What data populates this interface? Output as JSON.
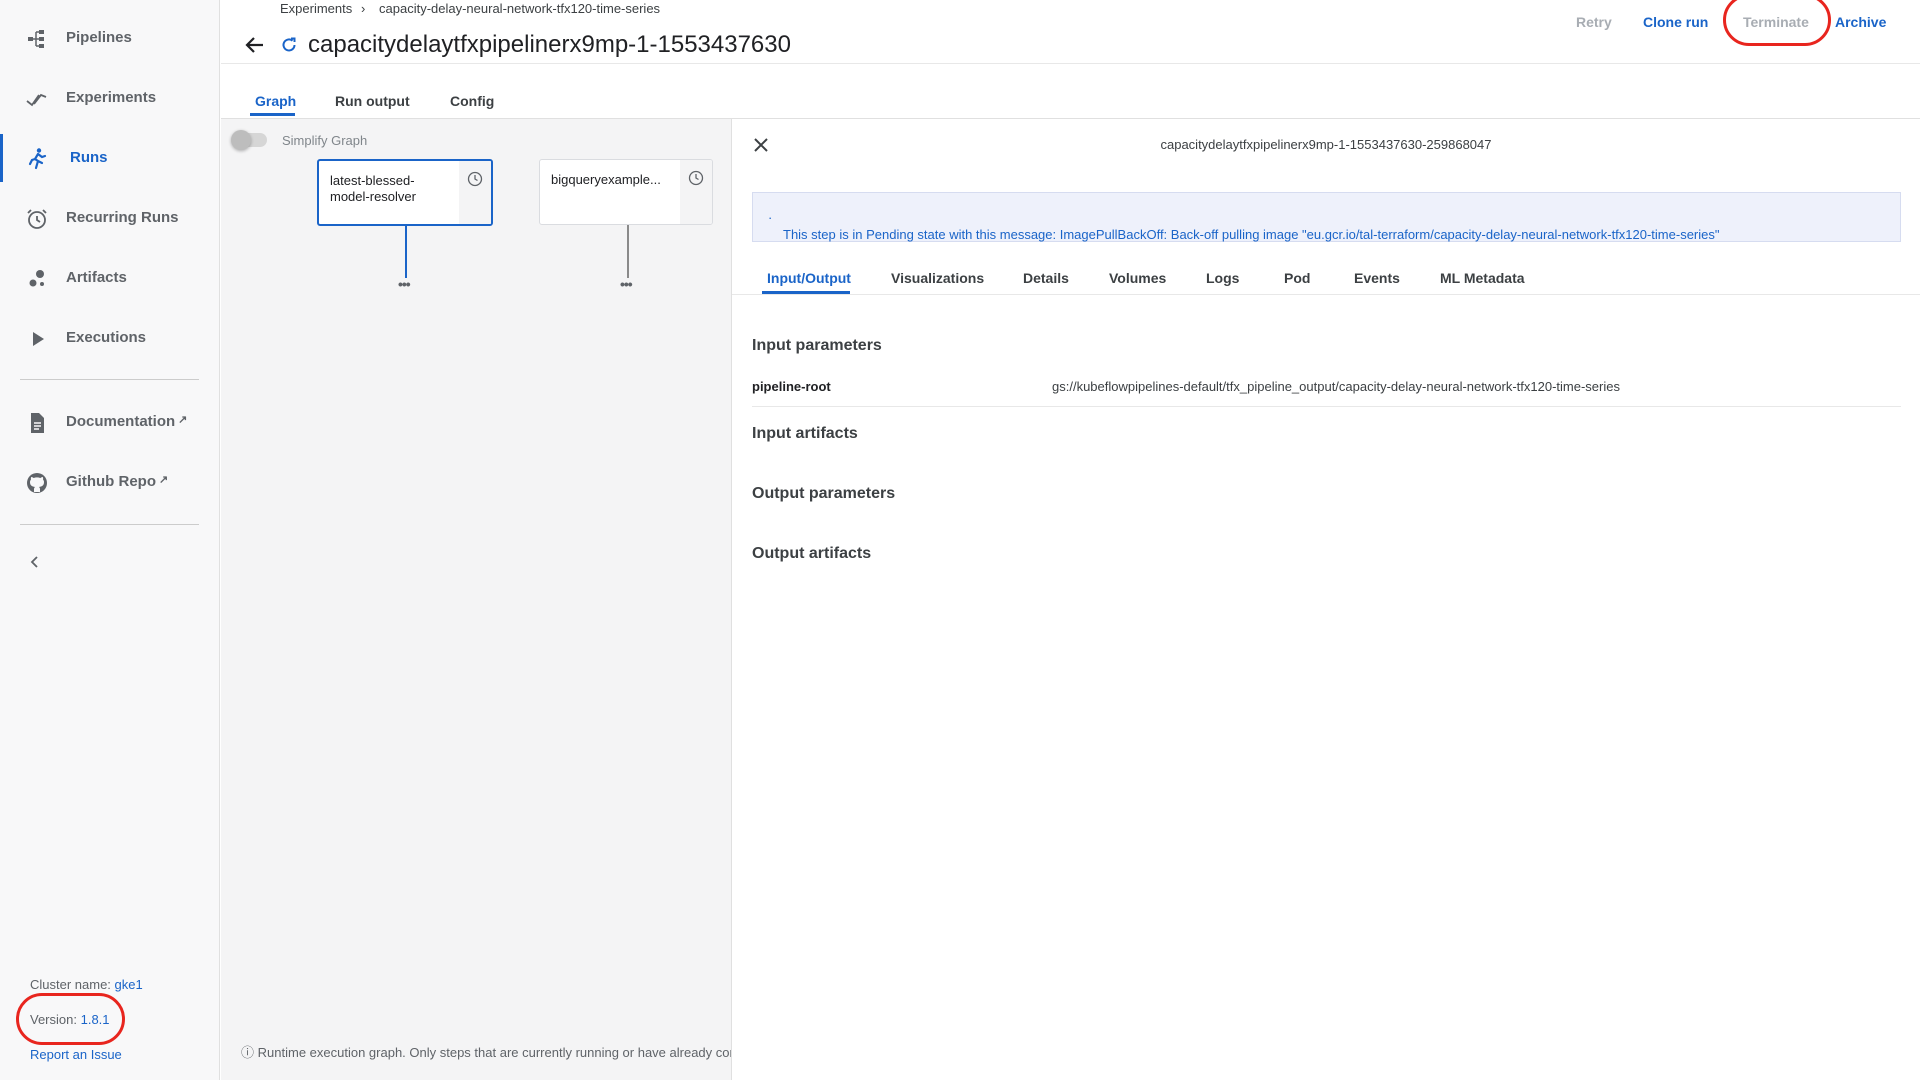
{
  "sidebar": {
    "items": [
      {
        "label": "Pipelines",
        "icon": "pipelines-icon",
        "active": false
      },
      {
        "label": "Experiments",
        "icon": "experiments-icon",
        "active": false
      },
      {
        "label": "Runs",
        "icon": "runs-icon",
        "active": true
      },
      {
        "label": "Recurring Runs",
        "icon": "alarm-clock-icon",
        "active": false
      },
      {
        "label": "Artifacts",
        "icon": "artifacts-icon",
        "active": false
      },
      {
        "label": "Executions",
        "icon": "play-icon",
        "active": false
      }
    ],
    "links": [
      {
        "label": "Documentation",
        "icon": "document-icon"
      },
      {
        "label": "Github Repo",
        "icon": "github-icon"
      }
    ],
    "footer": {
      "cluster_label": "Cluster name:",
      "cluster_value": "gke1",
      "version_label": "Version:",
      "version_value": "1.8.1",
      "report_label": "Report an Issue"
    }
  },
  "header": {
    "breadcrumb": [
      "Experiments",
      "capacity-delay-neural-network-tfx120-time-series"
    ],
    "breadcrumb_separator": "›",
    "title": "capacitydelaytfxpipelinerx9mp-1-1553437630",
    "actions": [
      {
        "label": "Retry",
        "disabled": true
      },
      {
        "label": "Clone run",
        "disabled": false
      },
      {
        "label": "Terminate",
        "disabled": true
      },
      {
        "label": "Archive",
        "disabled": false
      }
    ],
    "tabs": [
      "Graph",
      "Run output",
      "Config"
    ],
    "active_tab": "Graph"
  },
  "graph": {
    "simplify_label": "Simplify Graph",
    "simplify_on": false,
    "nodes": [
      {
        "label": "latest-blessed-model-resolver",
        "selected": true
      },
      {
        "label": "bigqueryexample...",
        "selected": false
      }
    ],
    "footer_note": "Runtime execution graph. Only steps that are currently running or have already comp"
  },
  "panel": {
    "title": "capacitydelaytfxpipelinerx9mp-1-1553437630-259868047",
    "banner": "This step is in Pending state with this message: ImagePullBackOff: Back-off pulling image \"eu.gcr.io/tal-terraform/capacity-delay-neural-network-tfx120-time-series\"",
    "tabs": [
      "Input/Output",
      "Visualizations",
      "Details",
      "Volumes",
      "Logs",
      "Pod",
      "Events",
      "ML Metadata"
    ],
    "active_tab": "Input/Output",
    "sections": {
      "input_parameters": "Input parameters",
      "input_artifacts": "Input artifacts",
      "output_parameters": "Output parameters",
      "output_artifacts": "Output artifacts"
    },
    "params": [
      {
        "key": "pipeline-root",
        "value": "gs://kubeflowpipelines-default/tfx_pipeline_output/capacity-delay-neural-network-tfx120-time-series"
      }
    ]
  },
  "colors": {
    "accent": "#1a64c8",
    "sidebar_bg": "#f8f8f9",
    "graph_bg": "#f4f4f5",
    "annotation": "#e8251e"
  }
}
